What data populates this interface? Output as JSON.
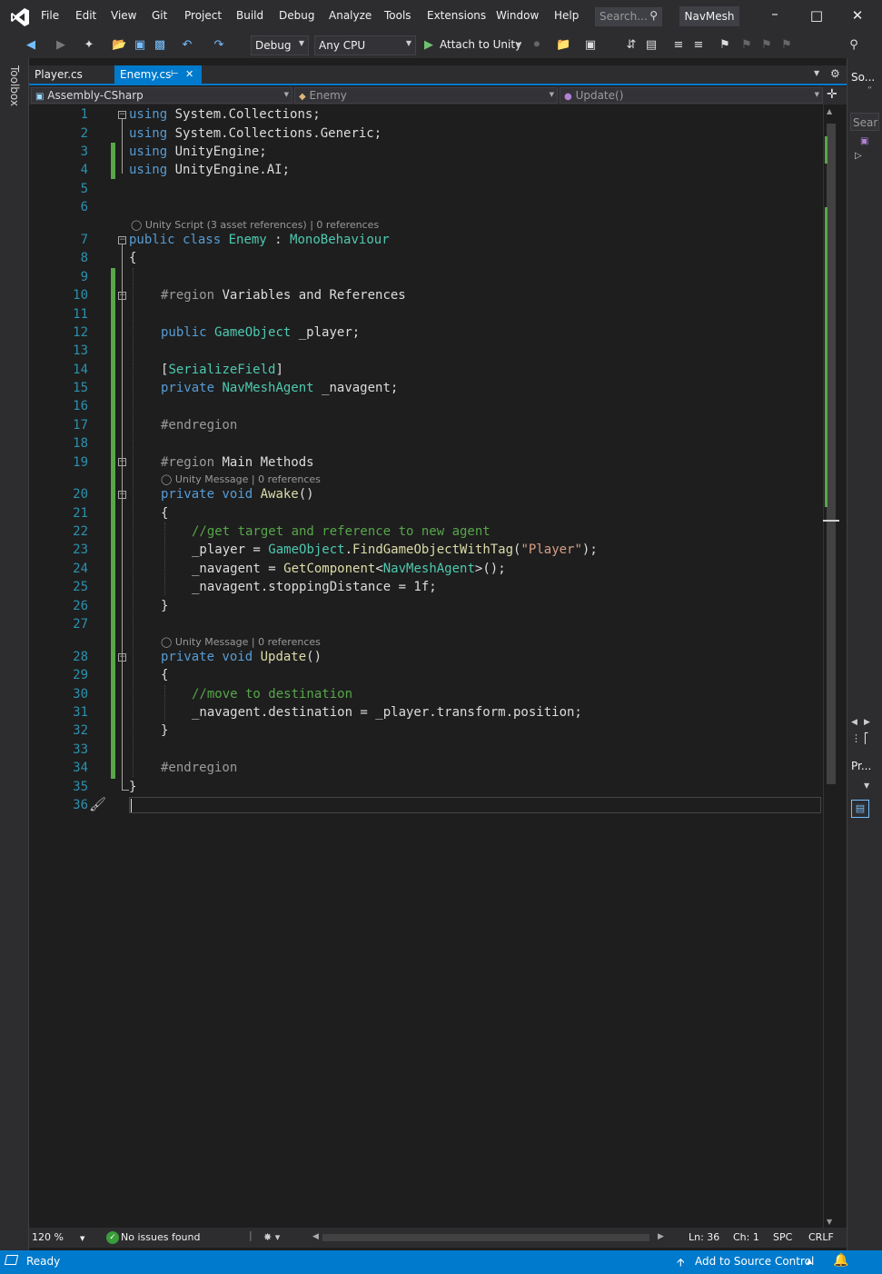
{
  "menu": {
    "items": [
      "File",
      "Edit",
      "View",
      "Git",
      "Project",
      "Build",
      "Debug",
      "Analyze",
      "Tools",
      "Extensions",
      "Window",
      "Help"
    ],
    "search_placeholder": "Search...",
    "solution_name": "NavMesh"
  },
  "toolbar": {
    "configuration": "Debug",
    "platform": "Any CPU",
    "attach_label": "Attach to Unity"
  },
  "sidebar": {
    "toolbox_label": "Toolbox"
  },
  "right_panel": {
    "solution_label": "So...",
    "search_label": "Sear",
    "properties_label": "Pr..."
  },
  "tabs": [
    {
      "label": "Player.cs"
    },
    {
      "label": "Enemy.cs"
    }
  ],
  "navbar": {
    "project": "Assembly-CSharp",
    "class": "Enemy",
    "member": "Update()"
  },
  "codelens": {
    "class_lens": "Unity Script (3 asset references) | 0 references",
    "awake_lens": "Unity Message | 0 references",
    "update_lens": "Unity Message | 0 references"
  },
  "line_numbers": [
    "1",
    "2",
    "3",
    "4",
    "5",
    "6",
    "7",
    "8",
    "9",
    "10",
    "11",
    "12",
    "13",
    "14",
    "15",
    "16",
    "17",
    "18",
    "19",
    "20",
    "21",
    "22",
    "23",
    "24",
    "25",
    "26",
    "27",
    "28",
    "29",
    "30",
    "31",
    "32",
    "33",
    "34",
    "35",
    "36"
  ],
  "code": {
    "l1_kw": "using",
    "l1_rest": " System.Collections;",
    "l2_kw": "using",
    "l2_rest": " System.Collections.Generic;",
    "l3_kw": "using",
    "l3_rest": " UnityEngine;",
    "l4_kw": "using",
    "l4_rest": " UnityEngine.AI;",
    "l7_kw": "public class",
    "l7_name": "Enemy",
    "l7_colon": " : ",
    "l7_base": "MonoBehaviour",
    "l8": "{",
    "l10_pp": "#region",
    "l10_rest": " Variables and References",
    "l12_kw": "public",
    "l12_type": "GameObject",
    "l12_rest": " _player;",
    "l14_open": "[",
    "l14_attr": "SerializeField",
    "l14_close": "]",
    "l15_kw": "private",
    "l15_type": "NavMeshAgent",
    "l15_rest": " _navagent;",
    "l17_pp": "#endregion",
    "l19_pp": "#region",
    "l19_rest": " Main Methods",
    "l20_kw": "private void",
    "l20_fn": "Awake",
    "l20_rest": "()",
    "l21": "{",
    "l22_cm": "//get target and reference to new agent",
    "l23_a": "_player = ",
    "l23_type": "GameObject",
    "l23_b": ".",
    "l23_fn": "FindGameObjectWithTag",
    "l23_c": "(",
    "l23_str": "\"Player\"",
    "l23_d": ");",
    "l24_a": "_navagent = ",
    "l24_fn": "GetComponent",
    "l24_b": "<",
    "l24_type": "NavMeshAgent",
    "l24_c": ">();",
    "l25": "_navagent.stoppingDistance = 1f;",
    "l26": "}",
    "l28_kw": "private void",
    "l28_fn": "Update",
    "l28_rest": "()",
    "l29": "{",
    "l30_cm": "//move to destination",
    "l31": "_navagent.destination = _player.transform.position;",
    "l32": "}",
    "l34_pp": "#endregion",
    "l35": "}"
  },
  "editor_status": {
    "zoom": "120 %",
    "issues": "No issues found",
    "line": "Ln: 36",
    "col": "Ch: 1",
    "spacing": "SPC",
    "eol": "CRLF"
  },
  "statusbar": {
    "ready": "Ready",
    "source_control": "Add to Source Control"
  },
  "colors": {
    "accent": "#007acc",
    "keyword": "#569cd6",
    "type": "#4ec9b0",
    "comment": "#57a64a",
    "string": "#d69d85",
    "line_number": "#2b91af"
  }
}
